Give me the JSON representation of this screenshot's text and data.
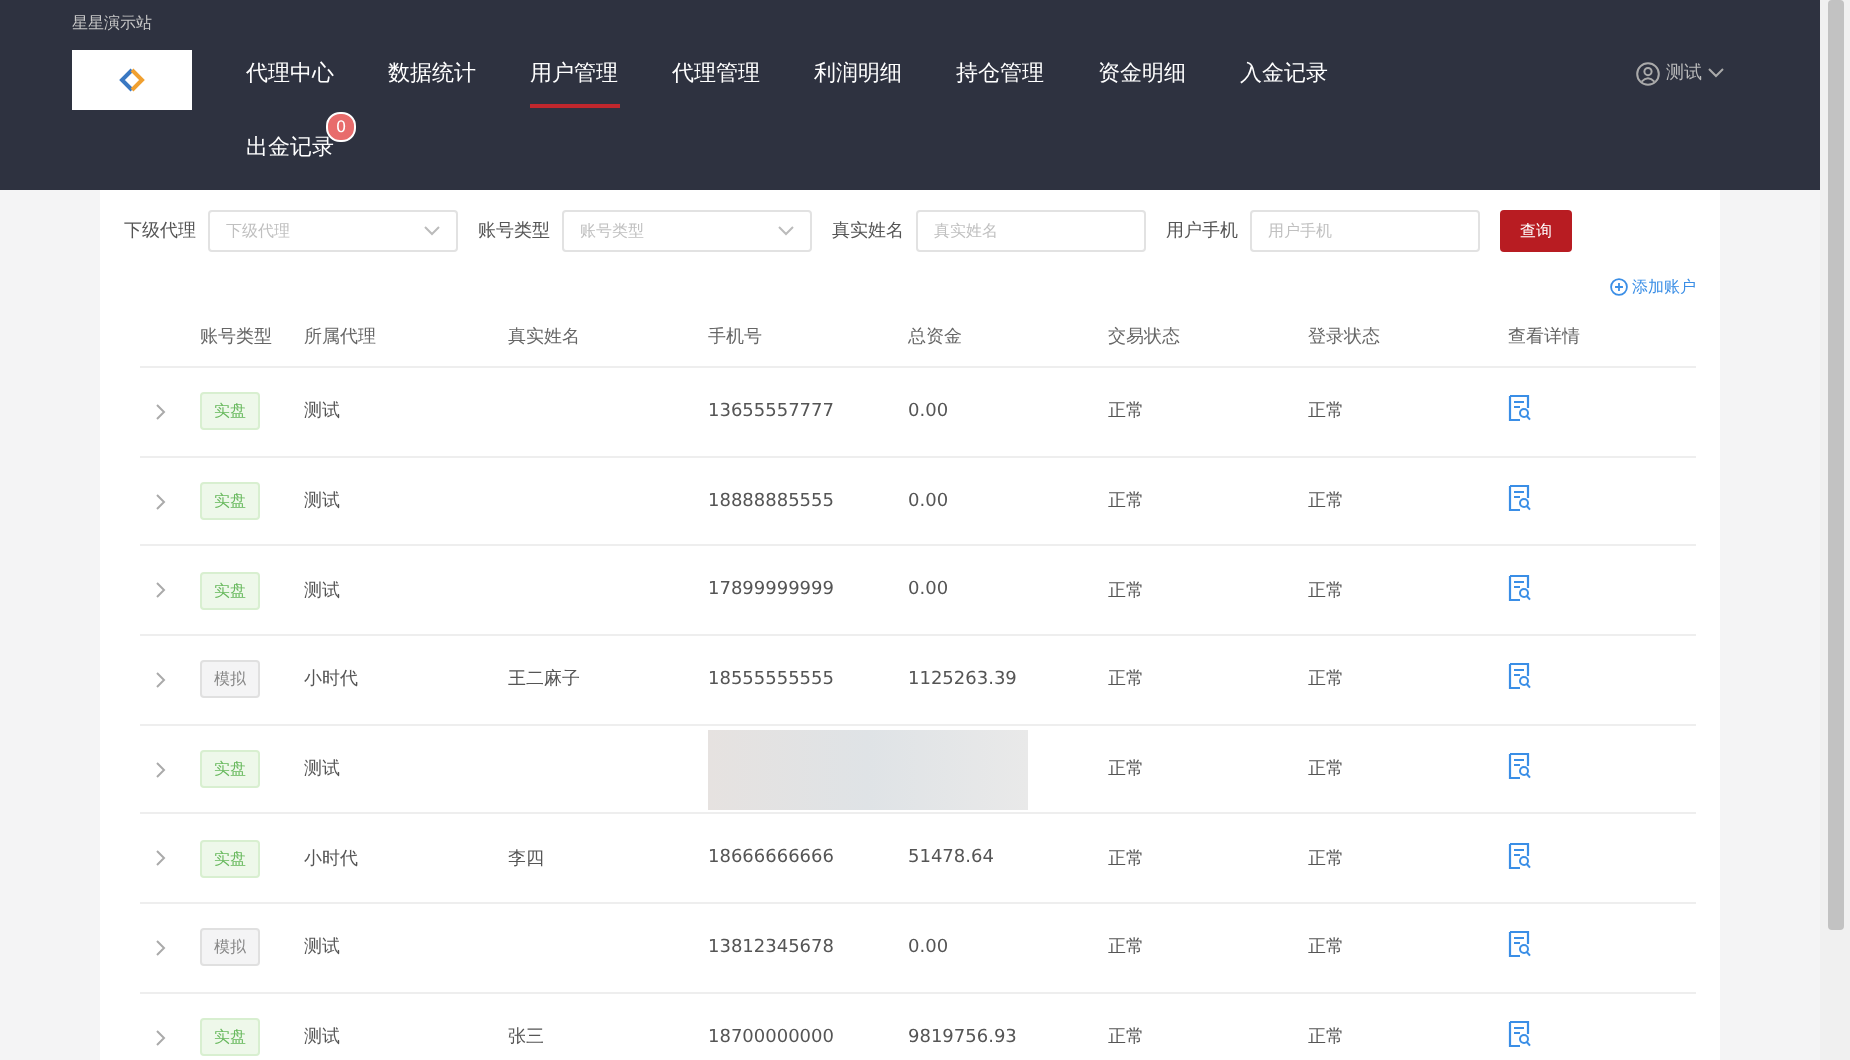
{
  "site_title": "星星演示站",
  "nav": [
    {
      "label": "代理中心",
      "selected": false
    },
    {
      "label": "数据统计",
      "selected": false
    },
    {
      "label": "用户管理",
      "selected": true
    },
    {
      "label": "代理管理",
      "selected": false
    },
    {
      "label": "利润明细",
      "selected": false
    },
    {
      "label": "持仓管理",
      "selected": false
    },
    {
      "label": "资金明细",
      "selected": false
    },
    {
      "label": "入金记录",
      "selected": false
    },
    {
      "label": "出金记录",
      "selected": false,
      "badge": "0"
    }
  ],
  "user": {
    "name": "测试"
  },
  "filters": [
    {
      "label": "下级代理",
      "kind": "select",
      "placeholder": "下级代理"
    },
    {
      "label": "账号类型",
      "kind": "select",
      "placeholder": "账号类型"
    },
    {
      "label": "真实姓名",
      "kind": "input",
      "placeholder": "真实姓名"
    },
    {
      "label": "用户手机",
      "kind": "input",
      "placeholder": "用户手机"
    }
  ],
  "search_button": "查询",
  "add_account": "添加账户",
  "table": {
    "columns": [
      "账号类型",
      "所属代理",
      "真实姓名",
      "手机号",
      "总资金",
      "交易状态",
      "登录状态",
      "查看详情"
    ],
    "rows": [
      {
        "type": {
          "label": "实盘",
          "kind": "real"
        },
        "agent": "测试",
        "phone": "13655557777",
        "total": "0.00",
        "trade_status": "正常",
        "login_status": "正常"
      },
      {
        "type": {
          "label": "实盘",
          "kind": "real"
        },
        "agent": "测试",
        "phone": "18888885555",
        "total": "0.00",
        "trade_status": "正常",
        "login_status": "正常"
      },
      {
        "type": {
          "label": "实盘",
          "kind": "real"
        },
        "agent": "测试",
        "phone": "17899999999",
        "total": "0.00",
        "trade_status": "正常",
        "login_status": "正常"
      },
      {
        "type": {
          "label": "模拟",
          "kind": "sim"
        },
        "agent": "小时代",
        "name": "王二麻子",
        "phone": "18555555555",
        "total": "1125263.39",
        "trade_status": "正常",
        "login_status": "正常"
      },
      {
        "type": {
          "label": "实盘",
          "kind": "real"
        },
        "agent": "测试",
        "redacted": true,
        "trade_status": "正常",
        "login_status": "正常"
      },
      {
        "type": {
          "label": "实盘",
          "kind": "real"
        },
        "agent": "小时代",
        "name": "李四",
        "phone": "18666666666",
        "total": "51478.64",
        "trade_status": "正常",
        "login_status": "正常"
      },
      {
        "type": {
          "label": "模拟",
          "kind": "sim"
        },
        "agent": "测试",
        "phone": "13812345678",
        "total": "0.00",
        "trade_status": "正常",
        "login_status": "正常"
      },
      {
        "type": {
          "label": "实盘",
          "kind": "real"
        },
        "agent": "测试",
        "name": "张三",
        "phone": "18700000000",
        "total": "9819756.93",
        "trade_status": "正常",
        "login_status": "正常"
      }
    ]
  }
}
